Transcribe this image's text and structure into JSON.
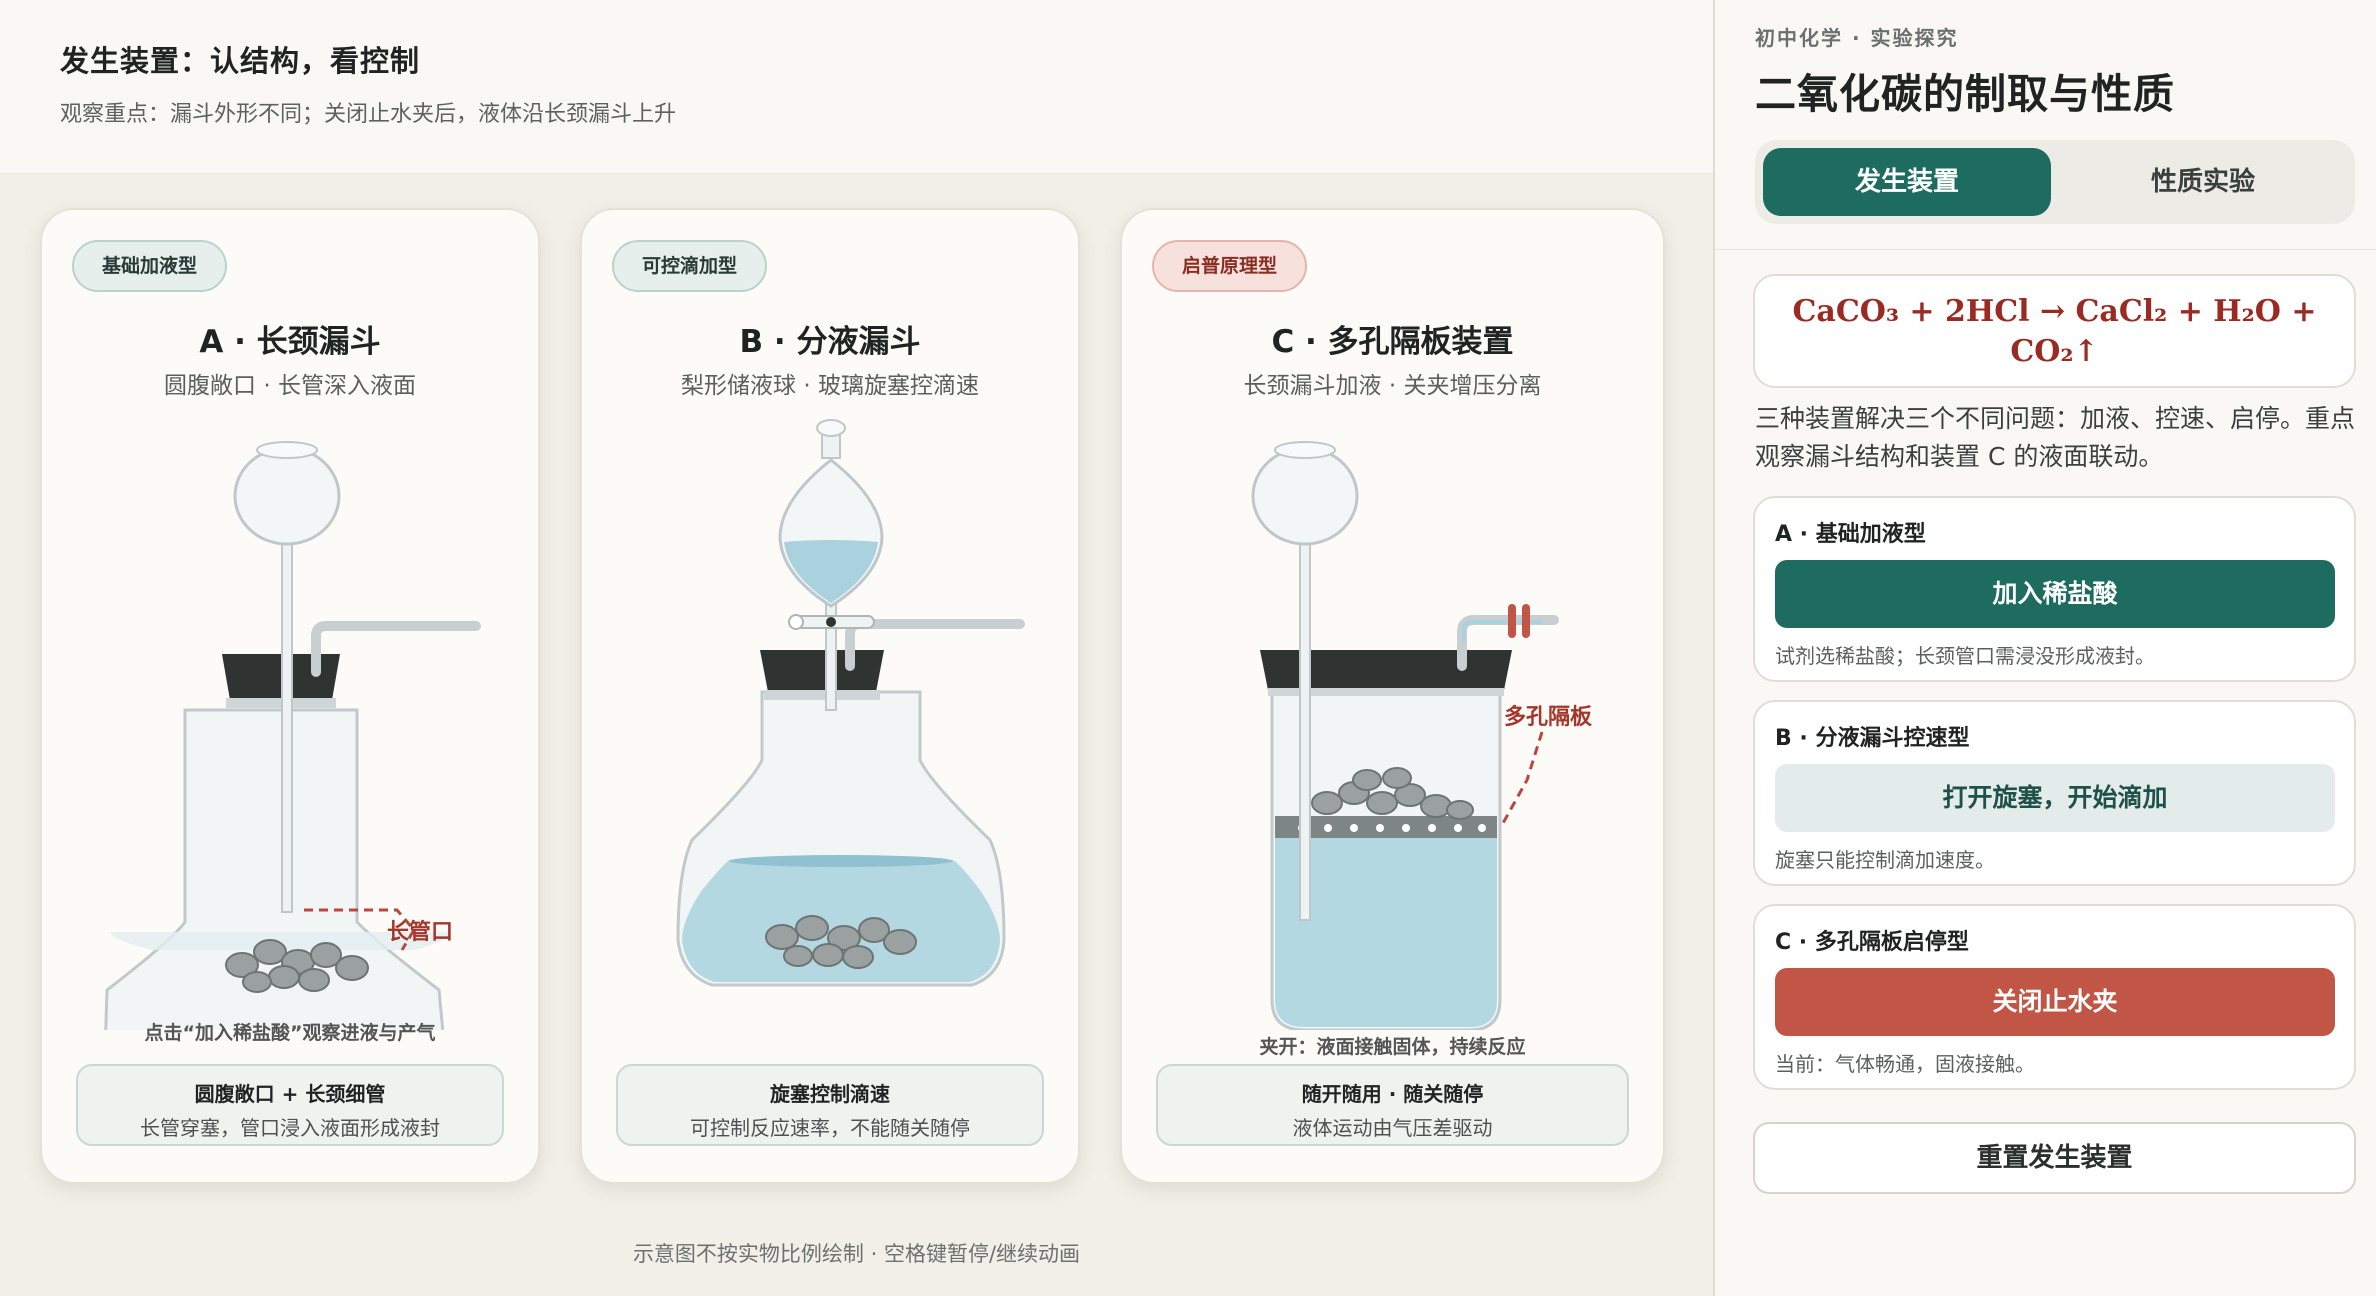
{
  "header": {
    "title": "发生装置：认结构，看控制",
    "subtitle": "观察重点：漏斗外形不同；关闭止水夹后，液体沿长颈漏斗上升"
  },
  "cards": [
    {
      "tag": "基础加液型",
      "title": "A · 长颈漏斗",
      "desc": "圆腹敞口 · 长管深入液面",
      "callout": "长管口",
      "note": "点击“加入稀盐酸”观察进液与产气",
      "info_title": "圆腹敞口 + 长颈细管",
      "info_desc": "长管穿塞，管口浸入液面形成液封"
    },
    {
      "tag": "可控滴加型",
      "title": "B · 分液漏斗",
      "desc": "梨形储液球 · 玻璃旋塞控滴速",
      "info_title": "旋塞控制滴速",
      "info_desc": "可控制反应速率，不能随关随停"
    },
    {
      "tag": "启普原理型",
      "title": "C · 多孔隔板装置",
      "desc": "长颈漏斗加液 · 关夹增压分离",
      "callout": "多孔隔板",
      "note": "夹开：液面接触固体，持续反应",
      "info_title": "随开随用 · 随关随停",
      "info_desc": "液体运动由气压差驱动"
    }
  ],
  "footer_note": "示意图不按实物比例绘制 · 空格键暂停/继续动画",
  "sidebar": {
    "eyebrow": "初中化学 · 实验探究",
    "title": "二氧化碳的制取与性质",
    "tabs": [
      {
        "label": "发生装置",
        "active": true
      },
      {
        "label": "性质实验",
        "active": false
      }
    ],
    "equation": "CaCO₃ + 2HCl → CaCl₂ + H₂O + CO₂↑",
    "intro": "三种装置解决三个不同问题：加液、控速、启停。重点观察漏斗结构和装置 C 的液面联动。",
    "controls": [
      {
        "title": "A · 基础加液型",
        "button": "加入稀盐酸",
        "hint": "试剂选稀盐酸；长颈管口需浸没形成液封。"
      },
      {
        "title": "B · 分液漏斗控速型",
        "button": "打开旋塞，开始滴加",
        "hint": "旋塞只能控制滴加速度。"
      },
      {
        "title": "C · 多孔隔板启停型",
        "button": "关闭止水夹",
        "hint": "当前：气体畅通，固液接触。"
      }
    ],
    "reset": "重置发生装置"
  },
  "colors": {
    "primary": "#1e6b60",
    "accent_red": "#c15546",
    "equation": "#9a2a22",
    "liquid": "#a9d2de"
  }
}
